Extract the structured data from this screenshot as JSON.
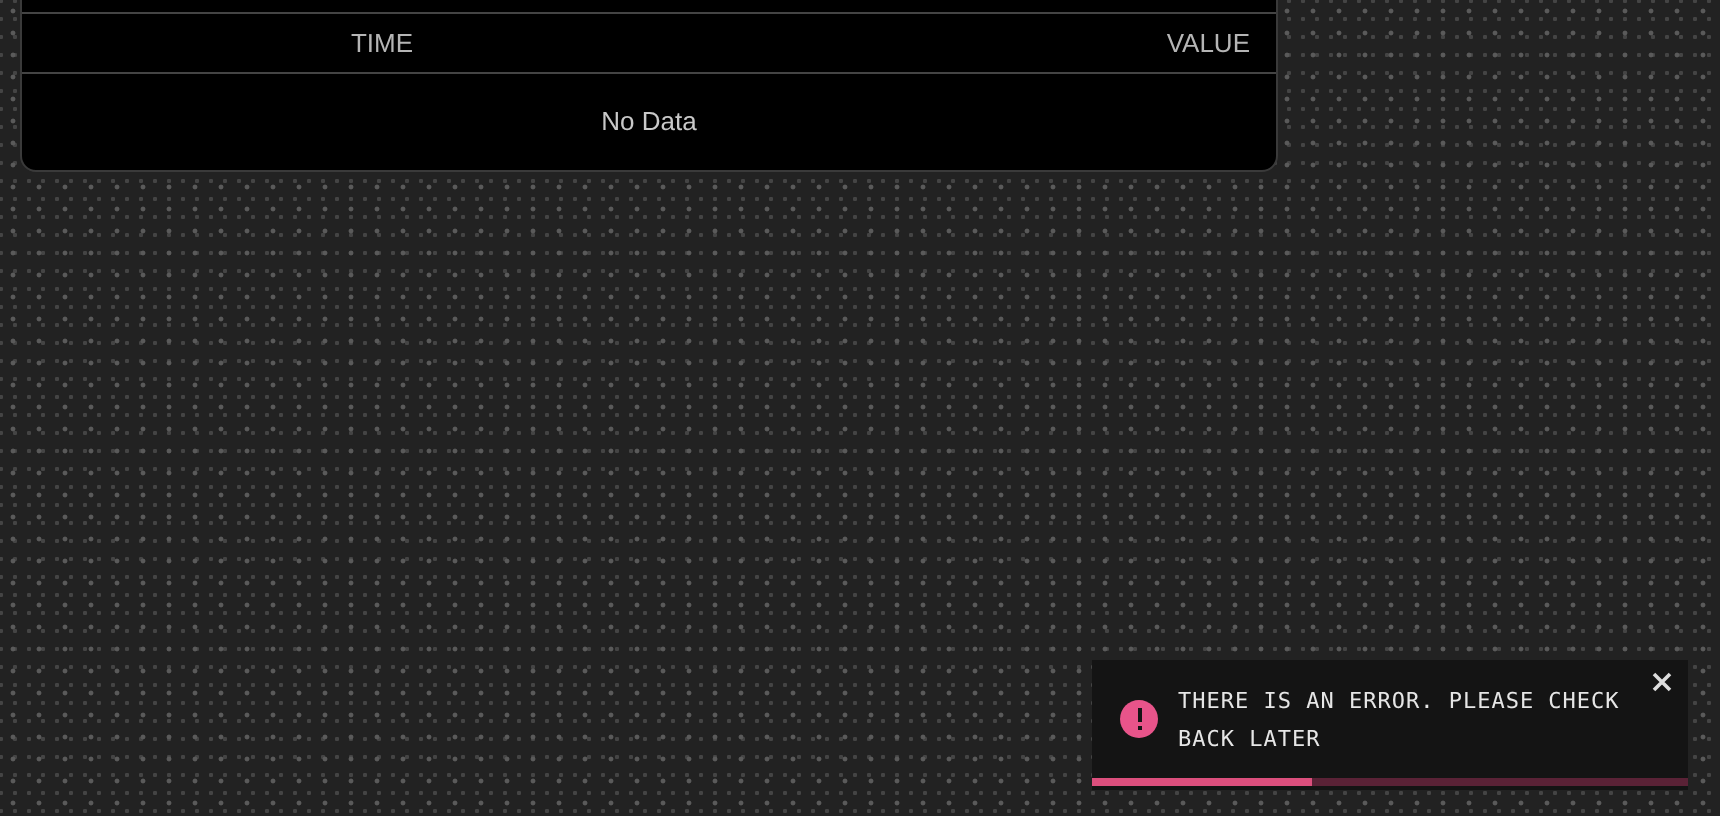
{
  "table": {
    "columns": [
      {
        "label": "TIME"
      },
      {
        "label": "VALUE"
      }
    ],
    "empty_text": "No Data"
  },
  "toast": {
    "message": "THERE IS AN ERROR. PLEASE CHECK BACK LATER",
    "level": 0.37
  }
}
